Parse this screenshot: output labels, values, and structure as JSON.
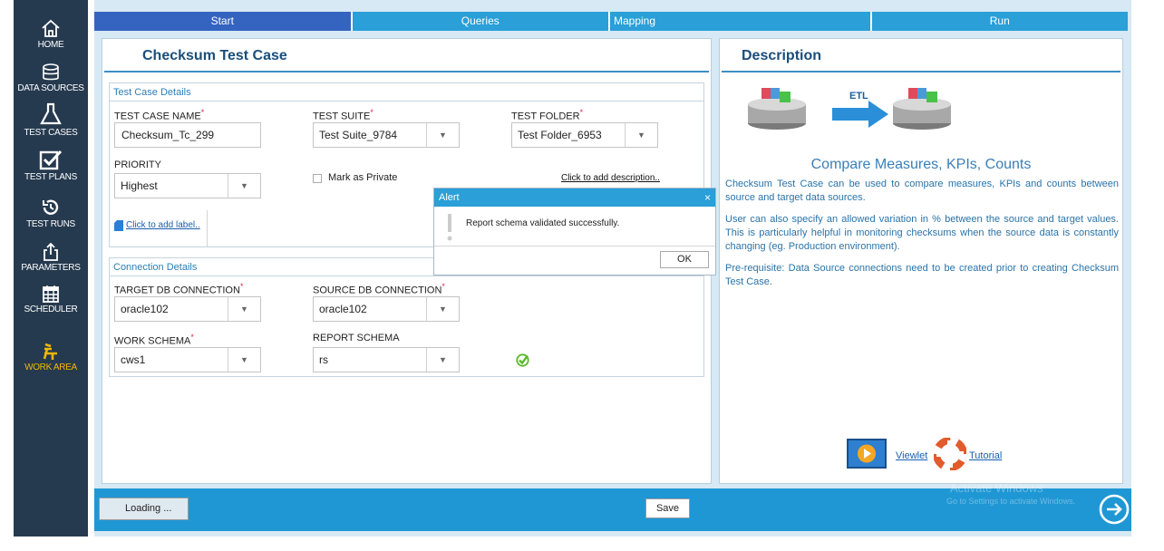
{
  "sidebar": {
    "items": [
      {
        "label": "HOME",
        "icon": "home-icon"
      },
      {
        "label": "DATA SOURCES",
        "icon": "database-icon"
      },
      {
        "label": "TEST CASES",
        "icon": "flask-icon"
      },
      {
        "label": "TEST PLANS",
        "icon": "checkbox-icon"
      },
      {
        "label": "TEST RUNS",
        "icon": "history-icon"
      },
      {
        "label": "PARAMETERS",
        "icon": "export-icon"
      },
      {
        "label": "SCHEDULER",
        "icon": "calendar-icon"
      },
      {
        "label": "WORK AREA",
        "icon": "work-area-icon"
      }
    ],
    "active_color": "#f2b600"
  },
  "tabs": [
    "Start",
    "Queries",
    "Mapping",
    "Run"
  ],
  "test_case": {
    "title": "Checksum Test Case",
    "details_header": "Test Case Details",
    "name_label": "TEST CASE NAME",
    "name_value": "Checksum_Tc_299",
    "suite_label": "TEST SUITE",
    "suite_value": "Test Suite_9784",
    "folder_label": "TEST FOLDER",
    "folder_value": "Test Folder_6953",
    "priority_label": "PRIORITY",
    "priority_value": "Highest",
    "private_label": "Mark as Private",
    "description_link": "Click to add description..",
    "label_link": "Click to add label..",
    "required_mark": "*"
  },
  "connection": {
    "header": "Connection Details",
    "target_label": "TARGET DB CONNECTION",
    "target_value": "oracle102",
    "source_label": "SOURCE DB CONNECTION",
    "source_value": "oracle102",
    "work_schema_label": "WORK SCHEMA",
    "work_schema_value": "cws1",
    "report_schema_label": "REPORT SCHEMA",
    "report_schema_value": "rs"
  },
  "alert": {
    "title": "Alert",
    "close": "×",
    "message": "Report schema validated successfully.",
    "ok": "OK"
  },
  "description": {
    "title": "Description",
    "etl_label": "ETL",
    "heading": "Compare Measures, KPIs, Counts",
    "para1": "Checksum Test Case can be used to compare measures, KPIs and counts between source and target data sources.",
    "para2": "User can also specify an allowed variation in % between the source and target values. This is particularly helpful in monitoring checksums when the source data is constantly changing (eg. Production environment).",
    "para3": "Pre-requisite: Data Source connections need to be created prior to creating Checksum Test Case.",
    "viewlet_link": "Viewlet",
    "tutorial_link": "Tutorial"
  },
  "bottom": {
    "loading": "Loading ...",
    "save": "Save",
    "watermark_title": "Activate Windows",
    "watermark_sub": "Go to Settings to activate Windows."
  },
  "colors": {
    "sidebar_bg": "#263a4f",
    "tab_bg": "#2a9fd8",
    "tab_active": "#3564c0",
    "bottom_bar": "#1f97d4",
    "check_green": "#5cb82c"
  }
}
